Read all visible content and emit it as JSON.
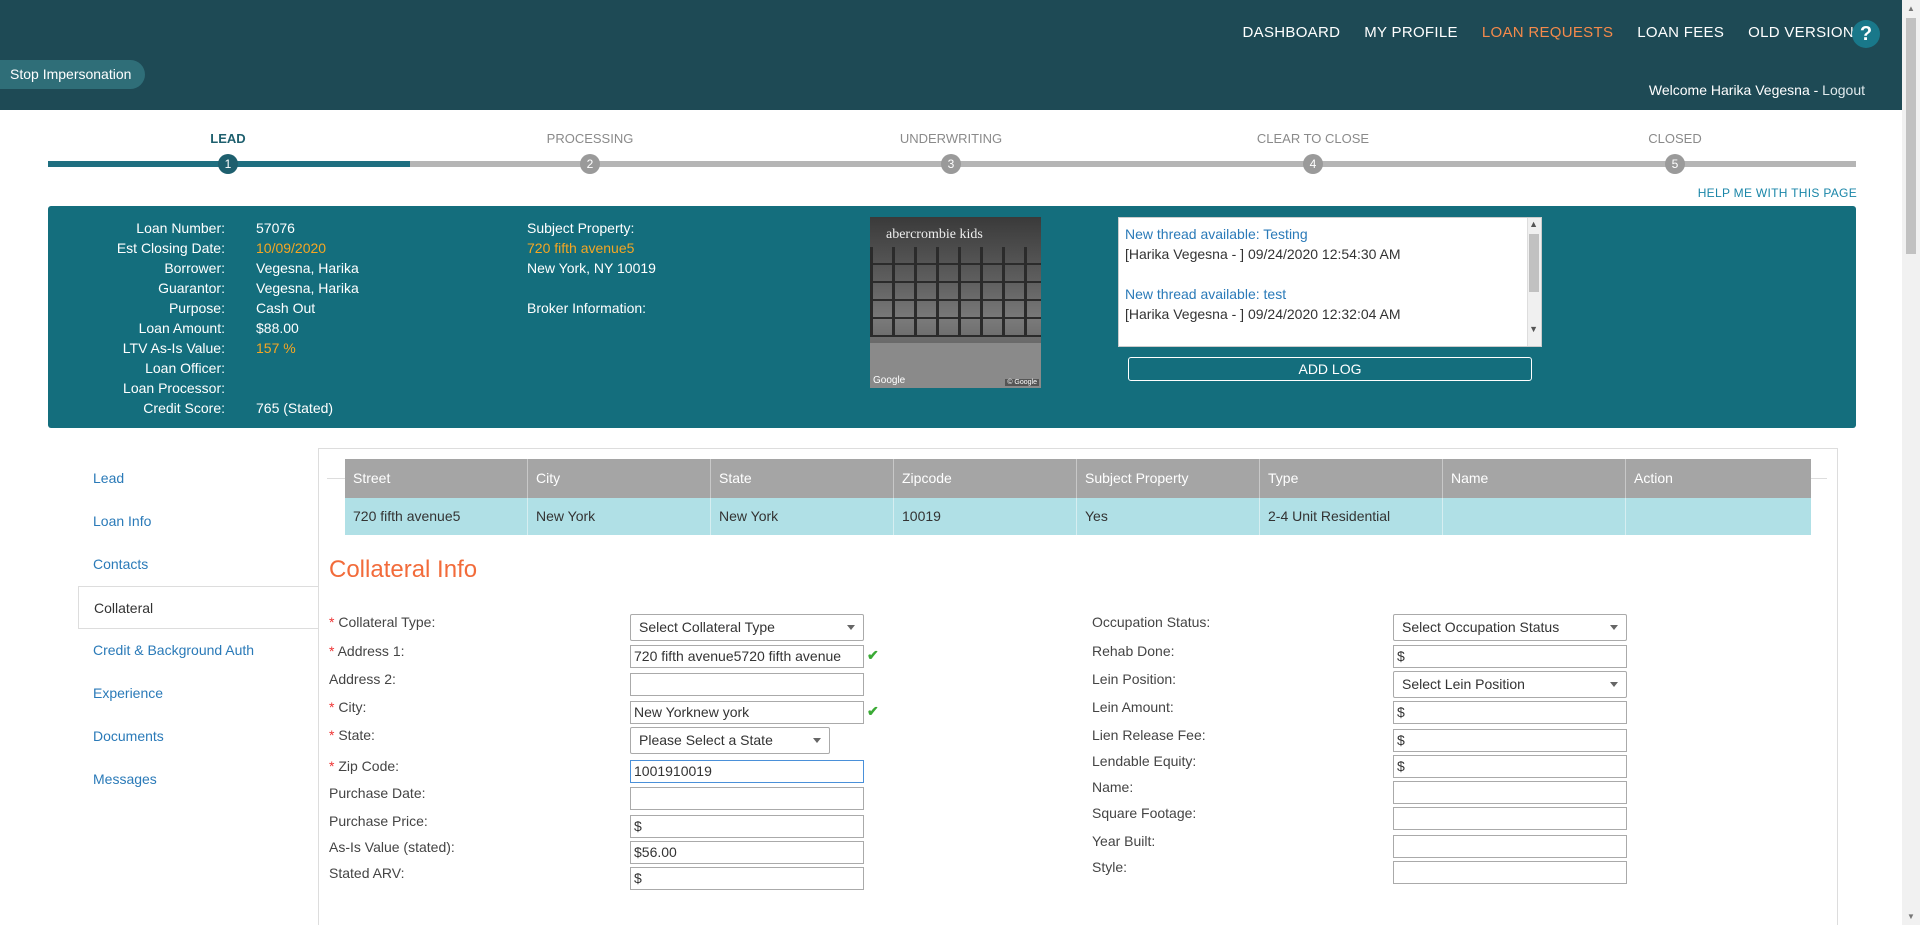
{
  "nav": {
    "items": [
      "DASHBOARD",
      "MY PROFILE",
      "LOAN REQUESTS",
      "LOAN FEES",
      "OLD VERSION"
    ],
    "active": "LOAN REQUESTS",
    "help": "?"
  },
  "stop_impersonation": "Stop Impersonation",
  "welcome": {
    "text": "Welcome Harika Vegesna - ",
    "logout": "Logout"
  },
  "progress": {
    "steps": [
      {
        "label": "LEAD",
        "num": "1"
      },
      {
        "label": "PROCESSING",
        "num": "2"
      },
      {
        "label": "UNDERWRITING",
        "num": "3"
      },
      {
        "label": "CLEAR TO CLOSE",
        "num": "4"
      },
      {
        "label": "CLOSED",
        "num": "5"
      }
    ],
    "current_step": 1
  },
  "help_page": "HELP ME WITH THIS PAGE",
  "summary": {
    "fields": [
      {
        "k": "Loan Number:",
        "v": "57076",
        "orange": false
      },
      {
        "k": "Est Closing Date:",
        "v": "10/09/2020",
        "orange": true
      },
      {
        "k": "Borrower:",
        "v": "Vegesna, Harika",
        "orange": false
      },
      {
        "k": "Guarantor:",
        "v": "Vegesna, Harika",
        "orange": false
      },
      {
        "k": "Purpose:",
        "v": "Cash Out",
        "orange": false
      },
      {
        "k": "Loan Amount:",
        "v": "$88.00",
        "orange": false
      },
      {
        "k": "LTV As-Is Value:",
        "v": "157 %",
        "orange": true
      },
      {
        "k": "Loan Officer:",
        "v": "",
        "orange": false
      },
      {
        "k": "Loan Processor:",
        "v": "",
        "orange": false
      },
      {
        "k": "Credit Score:",
        "v": "765 (Stated)",
        "orange": false
      }
    ],
    "subject_label": "Subject Property:",
    "subject_street": "720 fifth avenue5",
    "subject_city": "New York, NY 10019",
    "broker_label": "Broker Information:",
    "photo_sign": "abercrombie kids",
    "photo_google": "Google",
    "photo_copy": "© Google",
    "logs": [
      {
        "title": "New thread available: Testing",
        "msg": "[Harika Vegesna - ] 09/24/2020 12:54:30 AM"
      },
      {
        "title": "New thread available: test",
        "msg": "[Harika Vegesna - ] 09/24/2020 12:32:04 AM"
      }
    ],
    "add_log": "ADD LOG"
  },
  "sidenav": [
    "Lead",
    "Loan Info",
    "Contacts",
    "Collateral",
    "Credit & Background Auth",
    "Experience",
    "Documents",
    "Messages"
  ],
  "sidenav_active": "Collateral",
  "table": {
    "headers": [
      "Street",
      "City",
      "State",
      "Zipcode",
      "Subject Property",
      "Type",
      "Name",
      "Action"
    ],
    "rows": [
      [
        "720 fifth avenue5",
        "New York",
        "New York",
        "10019",
        "Yes",
        "2-4 Unit Residential",
        "",
        ""
      ]
    ]
  },
  "collateral": {
    "title": "Collateral Info",
    "left": [
      {
        "label": "Collateral Type:",
        "required": true,
        "kind": "select",
        "value": "Select Collateral Type"
      },
      {
        "label": "Address 1:",
        "required": true,
        "kind": "input",
        "value": "720 fifth avenue5720 fifth avenue",
        "check": true
      },
      {
        "label": "Address 2:",
        "required": false,
        "kind": "input",
        "value": ""
      },
      {
        "label": "City:",
        "required": true,
        "kind": "input",
        "value": "New Yorknew york",
        "check": true
      },
      {
        "label": "State:",
        "required": true,
        "kind": "select",
        "value": "Please Select a State"
      },
      {
        "label": "Zip Code:",
        "required": true,
        "kind": "input",
        "value": "1001910019",
        "focus": true
      },
      {
        "label": "Purchase Date:",
        "required": false,
        "kind": "input",
        "value": ""
      },
      {
        "label": "Purchase Price:",
        "required": false,
        "kind": "input",
        "value": "$"
      },
      {
        "label": "As-Is Value (stated):",
        "required": false,
        "kind": "input",
        "value": "$56.00"
      },
      {
        "label": "Stated ARV:",
        "required": false,
        "kind": "input",
        "value": "$"
      }
    ],
    "right": [
      {
        "label": "Occupation Status:",
        "kind": "select",
        "value": "Select Occupation Status"
      },
      {
        "label": "Rehab Done:",
        "kind": "input",
        "value": "$"
      },
      {
        "label": "Lein Position:",
        "kind": "select",
        "value": "Select Lein Position"
      },
      {
        "label": "Lein Amount:",
        "kind": "input",
        "value": "$"
      },
      {
        "label": "Lien Release Fee:",
        "kind": "input",
        "value": "$"
      },
      {
        "label": "Lendable Equity:",
        "kind": "input",
        "value": "$"
      },
      {
        "label": "Name:",
        "kind": "input",
        "value": ""
      },
      {
        "label": "Square Footage:",
        "kind": "input",
        "value": ""
      },
      {
        "label": "Year Built:",
        "kind": "input",
        "value": ""
      },
      {
        "label": "Style:",
        "kind": "input",
        "value": ""
      }
    ]
  }
}
